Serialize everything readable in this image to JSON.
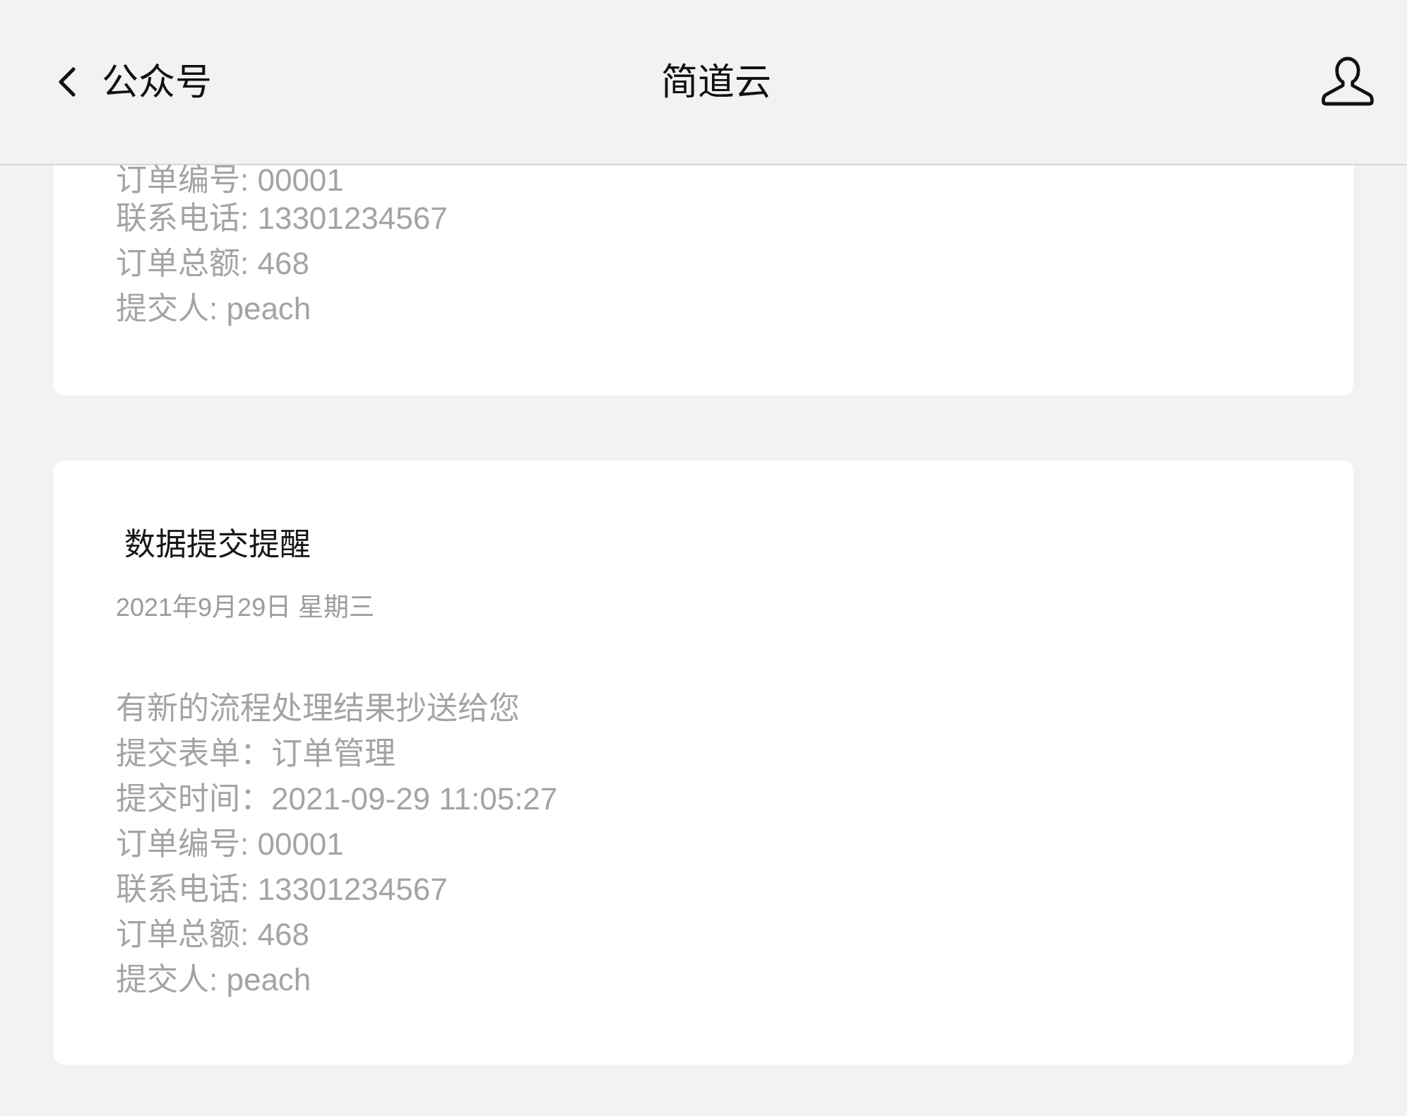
{
  "header": {
    "back_label": "公众号",
    "title": "简道云"
  },
  "messages": [
    {
      "lines": [
        "订单编号: 00001",
        "联系电话: 13301234567",
        "订单总额: 468",
        "提交人: peach"
      ]
    },
    {
      "title": "数据提交提醒",
      "date": "2021年9月29日 星期三",
      "lines": [
        "有新的流程处理结果抄送给您",
        "提交表单：订单管理",
        "提交时间：2021-09-29 11:05:27",
        "订单编号: 00001",
        "联系电话: 13301234567",
        "订单总额: 468",
        "提交人: peach"
      ]
    }
  ]
}
